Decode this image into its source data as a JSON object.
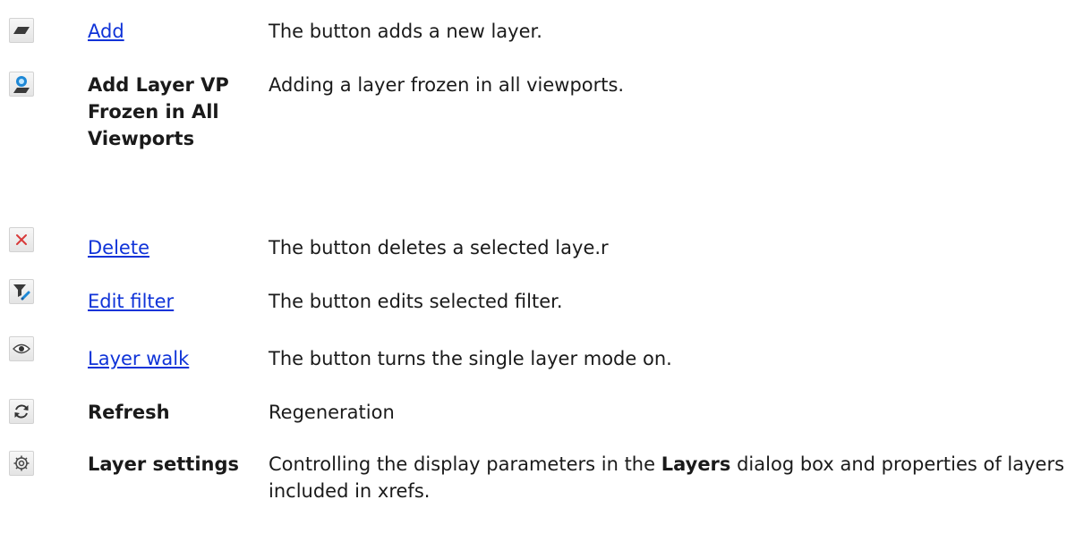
{
  "rows": [
    {
      "icon": "layer-add-icon",
      "name": "Add",
      "link": true,
      "desc": "The button adds a new layer."
    },
    {
      "icon": "layer-vp-frozen-icon",
      "name": "Add Layer VP Frozen in All Viewports",
      "link": false,
      "desc": "Adding a layer frozen in all viewports."
    },
    {
      "icon": "delete-x-icon",
      "name": "Delete",
      "link": true,
      "desc": "The button deletes a selected laye.r"
    },
    {
      "icon": "edit-filter-icon",
      "name": "Edit filter",
      "link": true,
      "desc": "The button edits selected filter."
    },
    {
      "icon": "eye-icon",
      "name": "Layer walk",
      "link": true,
      "desc": "The button turns the single layer mode on."
    },
    {
      "icon": "refresh-icon",
      "name": "Refresh",
      "link": false,
      "desc": "Regeneration"
    },
    {
      "icon": "gear-icon",
      "name": "Layer settings",
      "link": false,
      "desc_before": "Controlling the display parameters in the ",
      "desc_bold": "Layers",
      "desc_after": " dialog box and properties of layers included in xrefs."
    }
  ]
}
